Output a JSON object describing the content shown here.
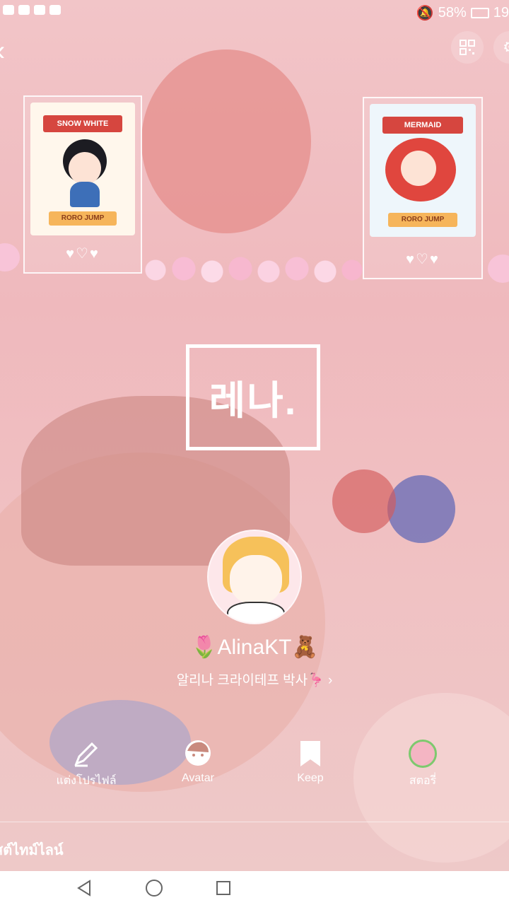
{
  "status_bar": {
    "battery": "58%",
    "time": "19"
  },
  "cards": {
    "left": {
      "banner": "SNOW WHITE",
      "footer": "RORO JUMP",
      "hearts": "♥♡♥"
    },
    "right": {
      "banner": "MERMAID",
      "footer": "RORO JUMP",
      "hearts": "♥♡♥"
    }
  },
  "cover_text": "레나.",
  "profile": {
    "name": "🌷AlinaKT🧸",
    "status_message": "알리나 크라이테프 박사🦩 ›"
  },
  "actions": [
    {
      "label": "แต่งโปรไฟล์",
      "icon": "edit-icon"
    },
    {
      "label": "Avatar",
      "icon": "avatar-icon"
    },
    {
      "label": "Keep",
      "icon": "bookmark-icon"
    },
    {
      "label": "สตอรี่",
      "icon": "story-icon"
    }
  ],
  "timeline_label": "สต์ไทม์ไลน์",
  "colors": {
    "background": "#f0c0c2",
    "card_banner": "#d6463f",
    "story_ring": "#7dc96e"
  }
}
